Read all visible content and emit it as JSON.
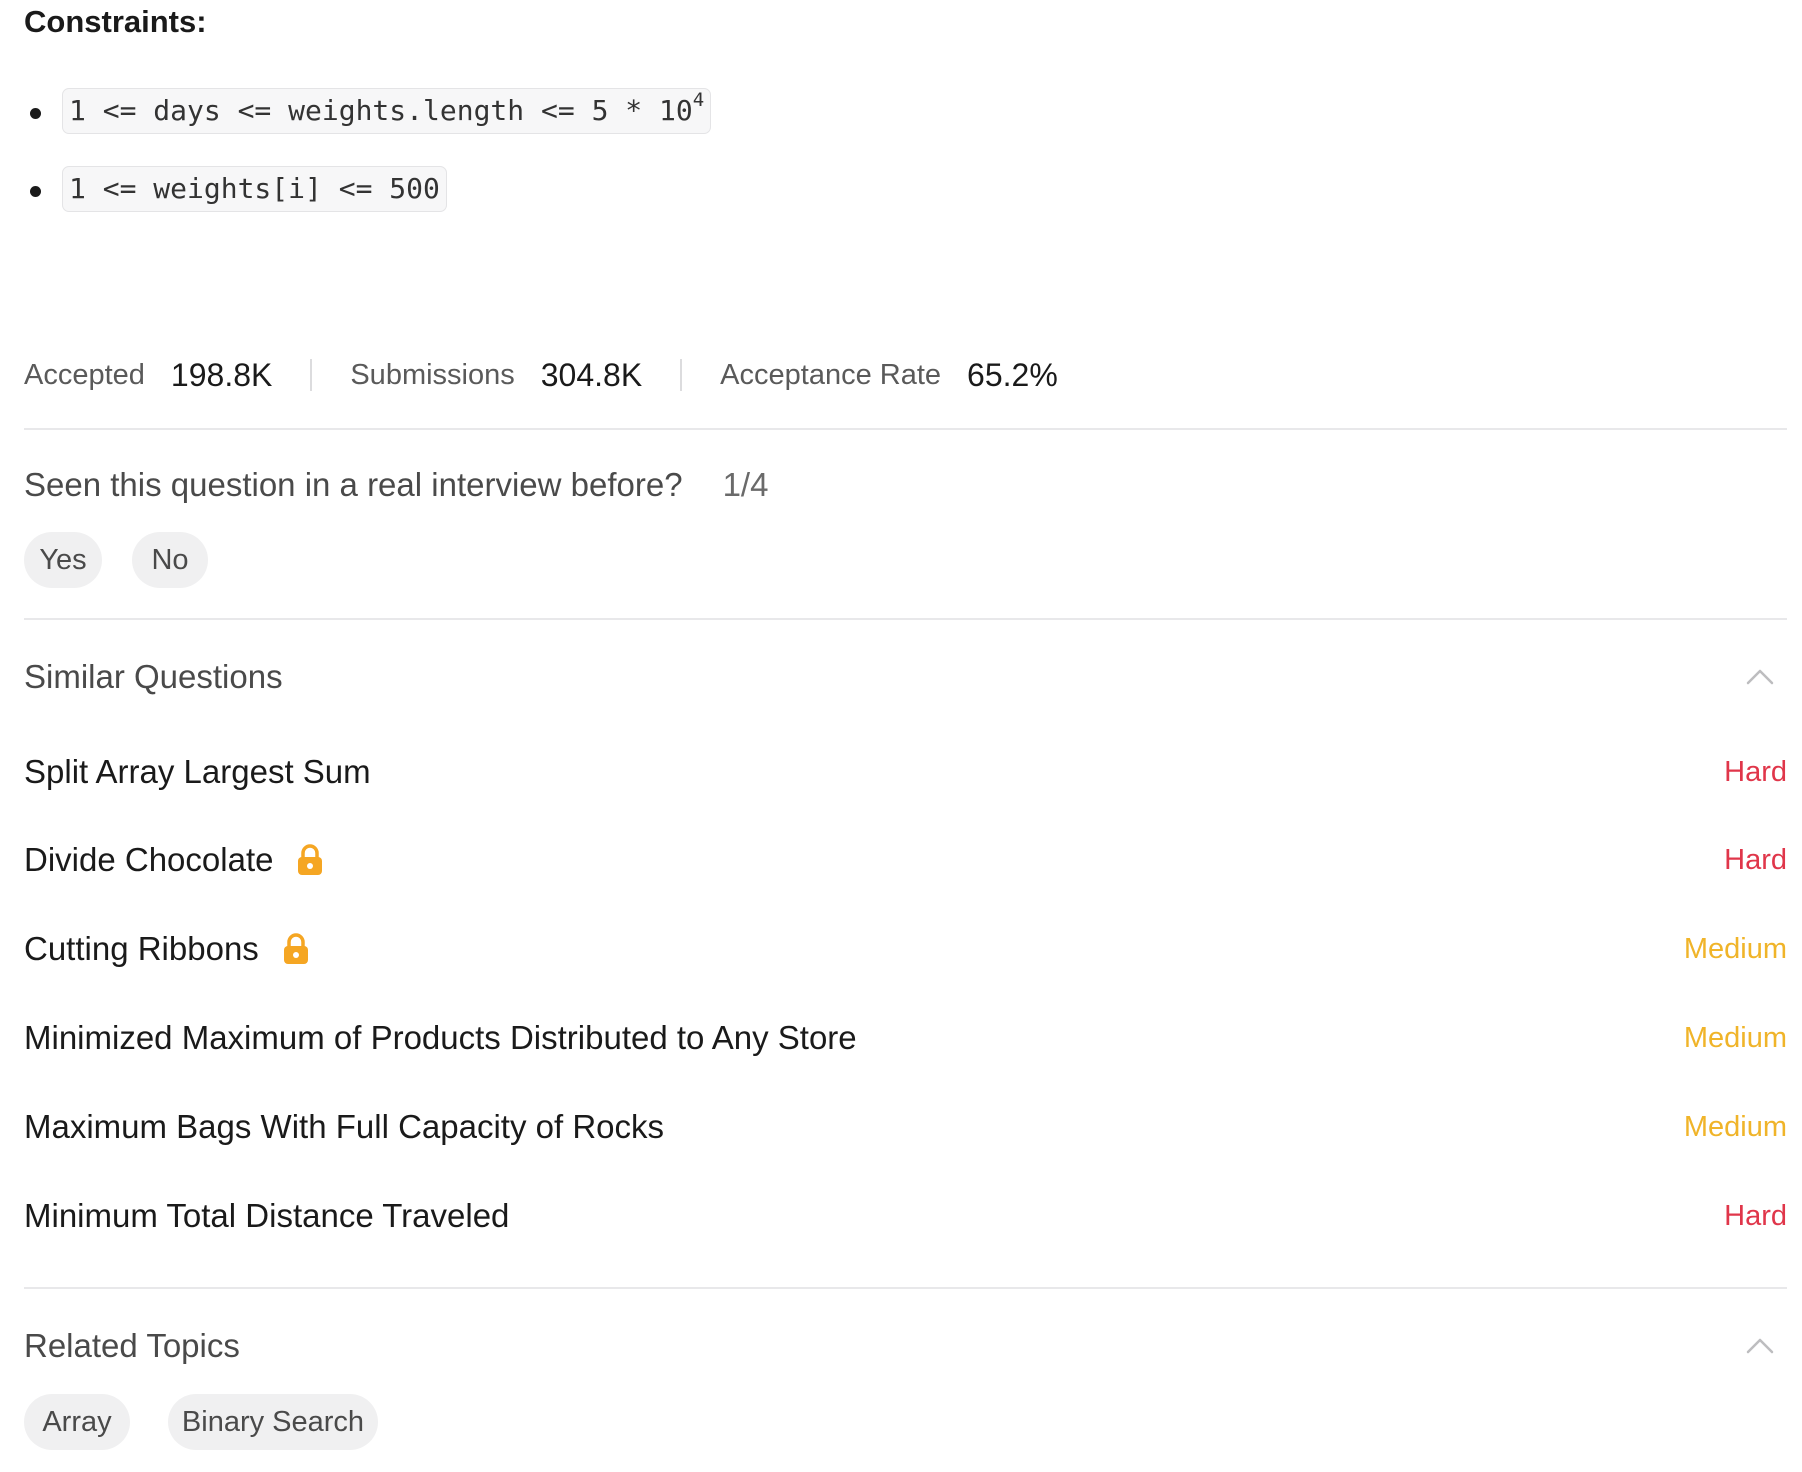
{
  "constraints": {
    "title": "Constraints:",
    "items": [
      {
        "code": "1 <= days <= weights.length <= 5 * 10",
        "sup": "4"
      },
      {
        "code": "1 <= weights[i] <= 500",
        "sup": ""
      }
    ]
  },
  "stats": {
    "accepted_label": "Accepted",
    "accepted_value": "198.8K",
    "submissions_label": "Submissions",
    "submissions_value": "304.8K",
    "acceptance_label": "Acceptance Rate",
    "acceptance_value": "65.2%"
  },
  "interview": {
    "question": "Seen this question in a real interview before?",
    "count": "1/4",
    "yes_label": "Yes",
    "no_label": "No"
  },
  "similar": {
    "title": "Similar Questions",
    "chevron_icon": "chevron-up-icon",
    "items": [
      {
        "title": "Split Array Largest Sum",
        "locked": false,
        "difficulty": "Hard"
      },
      {
        "title": "Divide Chocolate",
        "locked": true,
        "difficulty": "Hard"
      },
      {
        "title": "Cutting Ribbons",
        "locked": true,
        "difficulty": "Medium"
      },
      {
        "title": "Minimized Maximum of Products Distributed to Any Store",
        "locked": false,
        "difficulty": "Medium"
      },
      {
        "title": "Maximum Bags With Full Capacity of Rocks",
        "locked": false,
        "difficulty": "Medium"
      },
      {
        "title": "Minimum Total Distance Traveled",
        "locked": false,
        "difficulty": "Hard"
      }
    ]
  },
  "topics": {
    "title": "Related Topics",
    "chevron_icon": "chevron-up-icon",
    "tags": [
      "Array",
      "Binary Search"
    ]
  },
  "colors": {
    "hard": "#e0364a",
    "medium": "#f0b429",
    "lock": "#f5a623"
  }
}
